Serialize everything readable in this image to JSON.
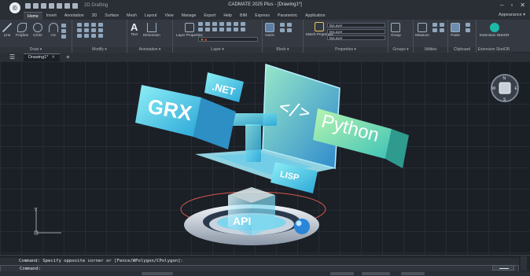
{
  "titlebar": {
    "app_logo": "©",
    "workspace": "2D Drafting",
    "title": "CADMATE 2025 Plus - [Drawing1*]",
    "minimize": "–",
    "restore": "▫",
    "close": "✕"
  },
  "ribbon_tabs": [
    "Home",
    "Insert",
    "Annotation",
    "3D",
    "Surface",
    "Mesh",
    "Layout",
    "View",
    "Manage",
    "Export",
    "Help",
    "BIM",
    "Express",
    "Parametric",
    "Application"
  ],
  "active_tab": "Home",
  "appearance": "Appearance ▾",
  "panels": {
    "draw": {
      "title": "Draw ▾",
      "tools": [
        "Line",
        "Polyline",
        "Circle",
        "Arc"
      ]
    },
    "modify": {
      "title": "Modify ▾"
    },
    "annotation": {
      "title": "Annotation ▾",
      "tools": [
        "Text",
        "Dimension"
      ]
    },
    "layer": {
      "title": "Layer ▾",
      "tools": [
        "Layer Properties"
      ]
    },
    "block": {
      "title": "Block ▾",
      "tools": [
        "Insert"
      ]
    },
    "properties": {
      "title": "Properties ▾",
      "tools": [
        "Match Properties"
      ],
      "bylayer": "ByLayer"
    },
    "groups": {
      "title": "Groups ▾",
      "tools": [
        "Group"
      ]
    },
    "utilities": {
      "title": "Utilities",
      "tools": [
        "Measure"
      ]
    },
    "clipboard": {
      "title": "Clipboard",
      "tools": [
        "Paste"
      ]
    },
    "extension": {
      "title": "Extension  SketOR",
      "tools": [
        "Extension SketOR"
      ]
    }
  },
  "document_tab": {
    "label": "Drawing1*",
    "close": "✕",
    "new": "+"
  },
  "hero": {
    "grx": "GRX",
    "net": ".NET",
    "code": "</>",
    "python": "Python",
    "lisp": "LISP",
    "api": "API"
  },
  "viewcube": {
    "n": "N",
    "w": "W",
    "e": "E",
    "s": "S"
  },
  "ucs": {
    "y": "Y"
  },
  "command": {
    "history": "Command: Specify opposite corner or [Fence/WPolygon/CPolygon]:",
    "prompt": "Command:"
  },
  "colors": {
    "accent": "#2a9df4",
    "hero_cyan": "#4fd1e8",
    "hero_green": "#7fe3a2",
    "background": "#1b1f26"
  }
}
